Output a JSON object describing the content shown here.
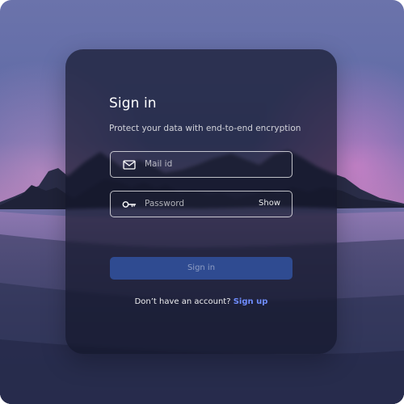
{
  "login": {
    "title": "Sign in",
    "subtitle": "Protect your data with end-to-end encryption",
    "email_placeholder": "Mail id",
    "password_placeholder": "Password",
    "show_label": "Show",
    "signin_label": "Sign in",
    "signup_prompt": "Don’t have an account?",
    "signup_link": "Sign up"
  },
  "icons": {
    "email": "mail-icon",
    "password": "key-icon"
  },
  "colors": {
    "accent": "#6f8dff",
    "button_bg": "#2f4b91",
    "card_bg": "#111428"
  }
}
